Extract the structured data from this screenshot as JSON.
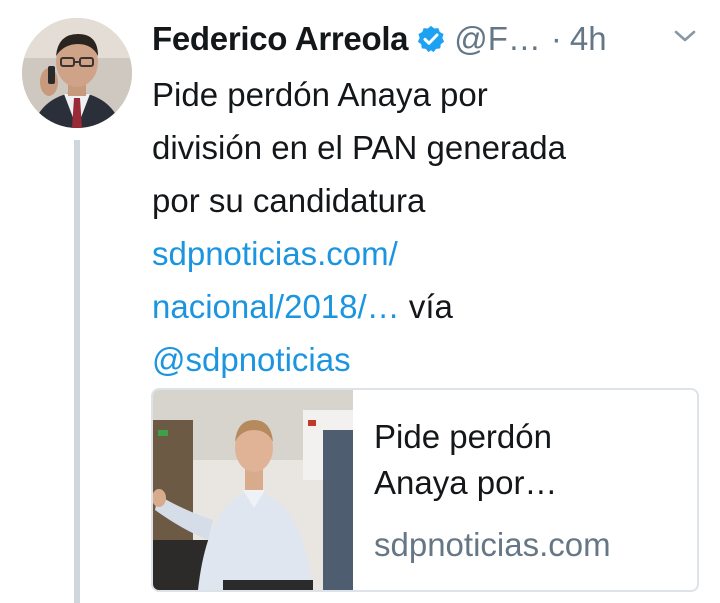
{
  "author": {
    "name": "Federico Arreola",
    "handle": "@F…",
    "separator": "·",
    "time": "4h"
  },
  "tweet": {
    "text_line_1": "Pide perdón Anaya por",
    "text_line_2": "división en el PAN generada",
    "text_line_3": "por su candidatura",
    "link_line_1": "sdpnoticias.com/",
    "link_line_2": "nacional/2018/…",
    "via": " vía",
    "mention": "@sdpnoticias"
  },
  "card": {
    "title_line_1": "Pide perdón",
    "title_line_2": "Anaya por…",
    "domain": "sdpnoticias.com"
  },
  "icons": {
    "verified": "verified-badge-icon",
    "caret": "chevron-down-icon"
  },
  "colors": {
    "link": "#1b95e0",
    "muted": "#657786",
    "verified": "#1da1f2",
    "text": "#14171a"
  }
}
